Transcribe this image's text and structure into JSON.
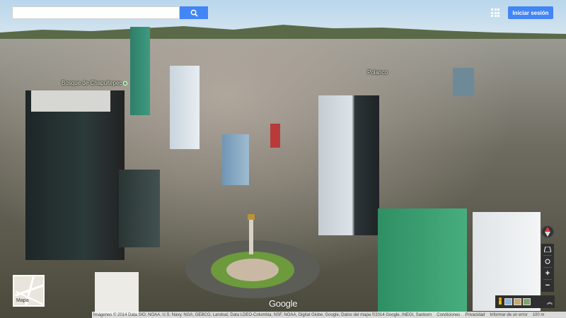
{
  "search": {
    "value": "",
    "placeholder": "",
    "button_icon": "search-icon"
  },
  "header": {
    "apps_icon": "apps-grid-icon",
    "signin_label": "Iniciar sesión"
  },
  "labels": {
    "bosque": "Bosque de Chapultepec",
    "polanco": "Polanco"
  },
  "map_thumbnail": {
    "label": "Mapa"
  },
  "controls": {
    "compass_icon": "compass-icon",
    "tilt_icon": "tilt-icon",
    "rotate_icon": "rotate-icon",
    "zoom_in": "+",
    "zoom_out": "−"
  },
  "toolbar": {
    "pegman_icon": "pegman-icon",
    "photos_icon": "photo-strip-icon",
    "expand_icon": "expand-up-icon"
  },
  "logo": "Google",
  "attribution": {
    "imagery": "Imágenes © 2014 Data SIO, NOAA, U.S. Navy, NGA, GEBCO, Landsat, Data LDEO-Columbia, NSF, NOAA, Digital Globe, Google, Datos del mapa ©2014 Google, INEGI, Sanborn",
    "terms": "Condiciones",
    "privacy": "Privacidad",
    "report": "Informar de un error",
    "scale": "100 m"
  },
  "colors": {
    "accent": "#4285f4",
    "control_bg": "#2f2f2f"
  }
}
